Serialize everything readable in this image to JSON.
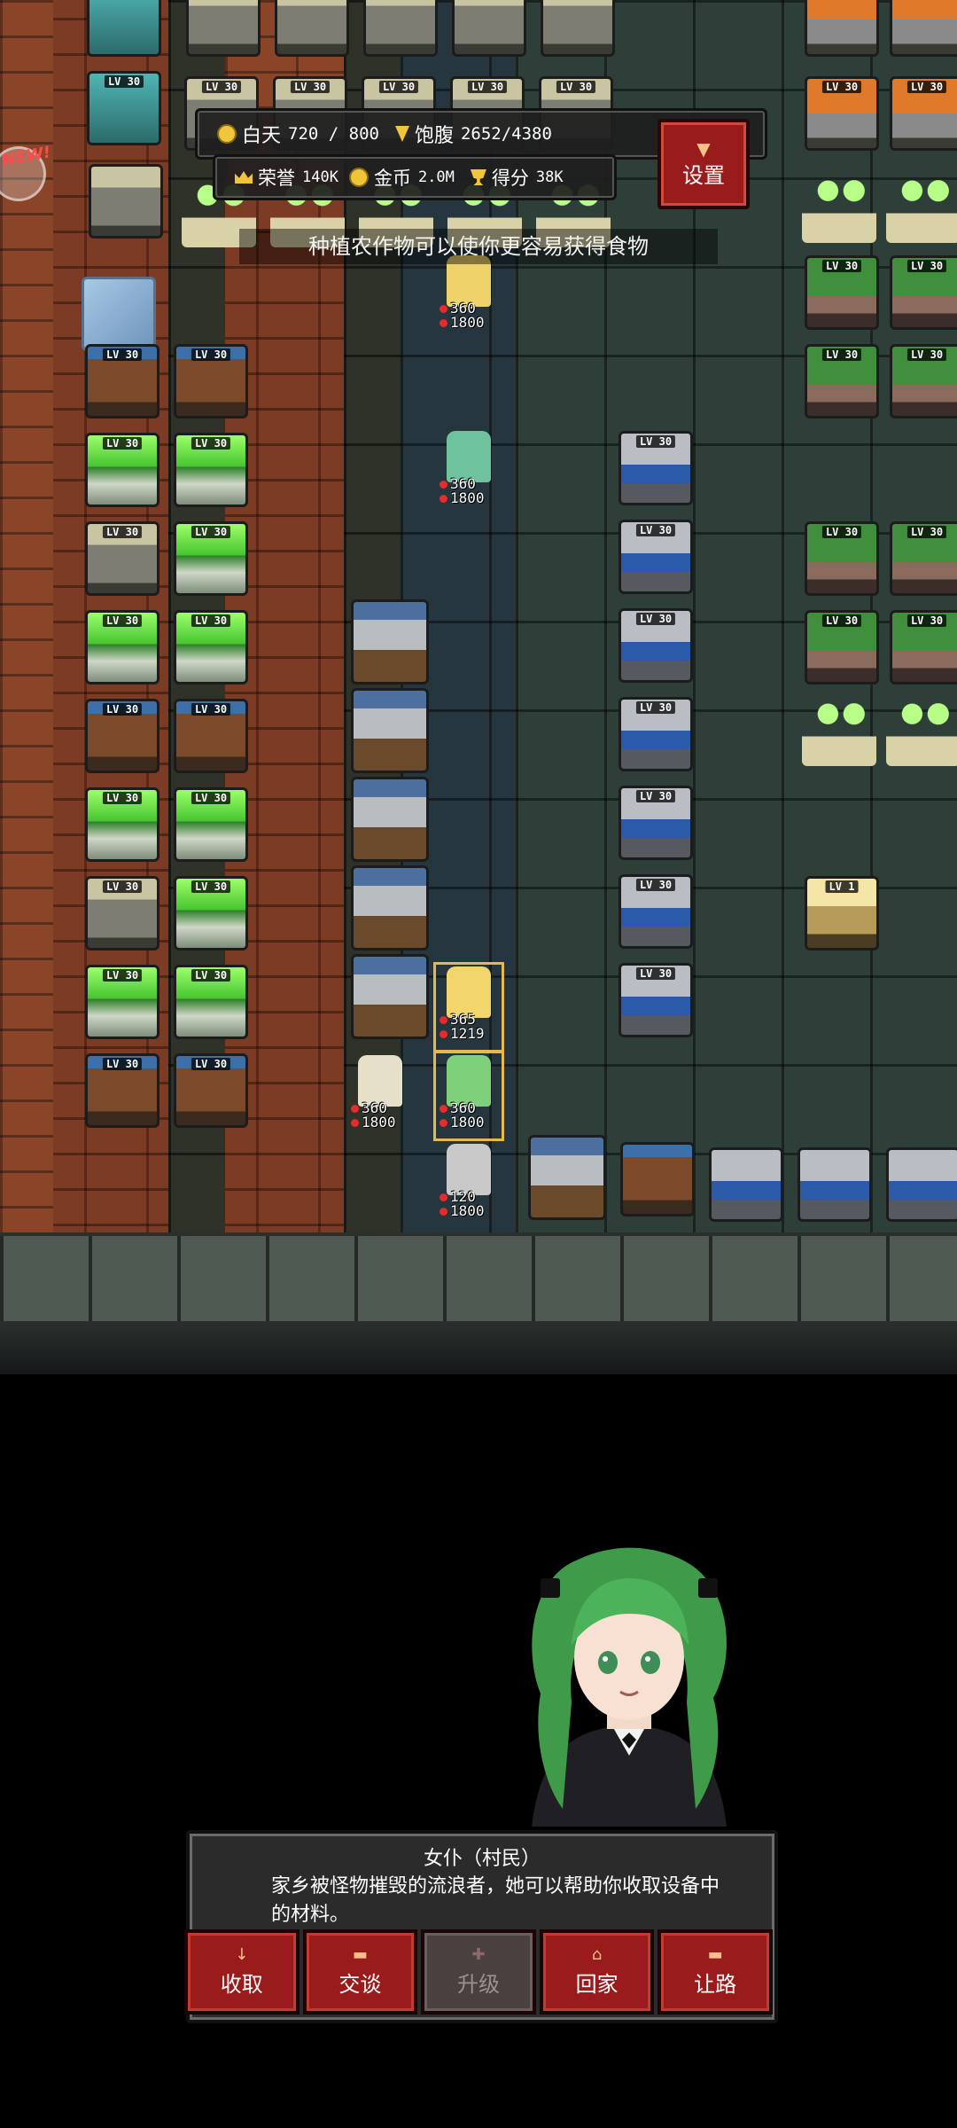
{
  "hud": {
    "day_label": "白天",
    "day_value": "720 / 800",
    "hunger_label": "饱腹",
    "hunger_value": "2652/4380",
    "honor_label": "荣誉",
    "honor_value": "140K",
    "gold_label": "金币",
    "gold_value": "2.0M",
    "score_label": "得分",
    "score_value": "38K",
    "settings_label": "设置"
  },
  "badge": {
    "new_label": "NEW!"
  },
  "tip": "种植农作物可以使你更容易获得食物",
  "tile_level": "LV 30",
  "altar_level": "LV 1",
  "units": [
    {
      "hp": "360",
      "max": "1800"
    },
    {
      "hp": "360",
      "max": "1800"
    },
    {
      "hp": "365",
      "max": "1219"
    },
    {
      "hp": "360",
      "max": "1800"
    },
    {
      "hp": "360",
      "max": "1800"
    },
    {
      "hp": "120",
      "max": "1800"
    }
  ],
  "dialog": {
    "name": "女仆（村民）",
    "body": "家乡被怪物摧毁的流浪者，她可以帮助你收取设备中的材料。"
  },
  "actions": [
    {
      "label": "收取",
      "icon": "↓",
      "enabled": true
    },
    {
      "label": "交谈",
      "icon": "▬",
      "enabled": true
    },
    {
      "label": "升级",
      "icon": "✚",
      "enabled": false
    },
    {
      "label": "回家",
      "icon": "⌂",
      "enabled": true
    },
    {
      "label": "让路",
      "icon": "▬",
      "enabled": true
    }
  ],
  "colors": {
    "button_red": "#9a1b1b",
    "gold": "#f0c53a",
    "hp_red": "#e52b2b"
  }
}
